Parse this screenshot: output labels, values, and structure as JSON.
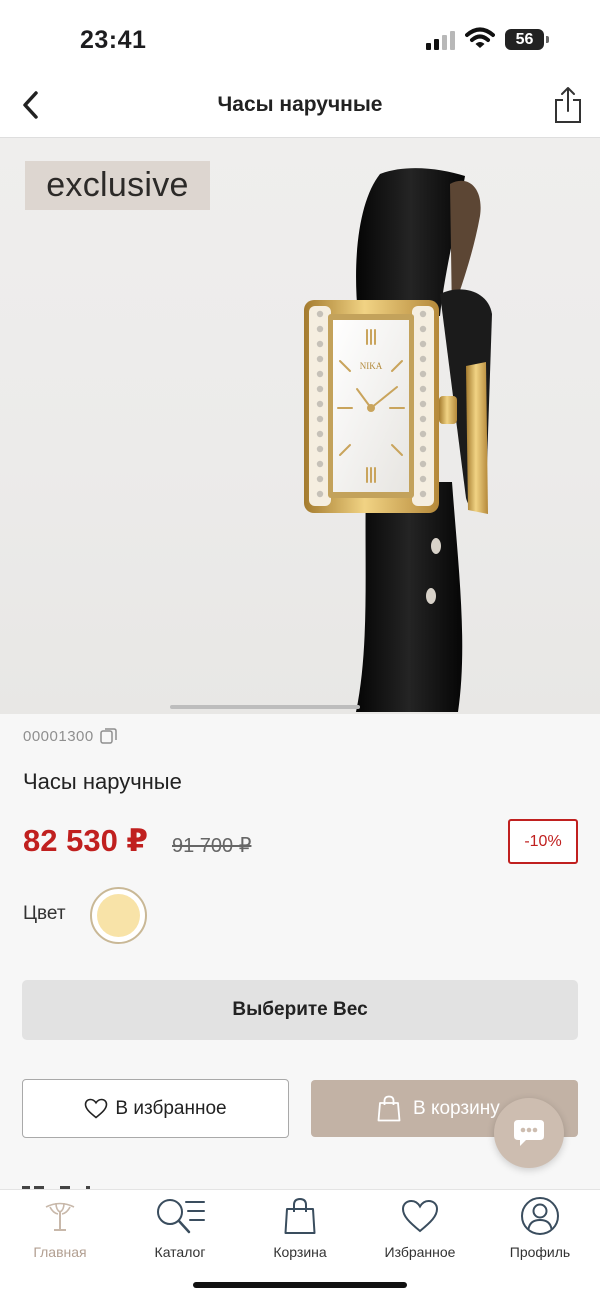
{
  "status_bar": {
    "time": "23:41",
    "battery": "56"
  },
  "header": {
    "title": "Часы наручные"
  },
  "product": {
    "badge": "exclusive",
    "watch_brand": "NIKA",
    "article": "00001300",
    "name": "Часы наручные",
    "price": "82 530 ₽",
    "old_price": "91 700 ₽",
    "discount": "-10%",
    "color_label": "Цвет",
    "swatch_color": "#f8e3a8"
  },
  "actions": {
    "select_weight": "Выберите Вес",
    "favorite": "В избранное",
    "cart": "В корзину"
  },
  "tabs": [
    {
      "label": "Главная",
      "icon": "tree-logo-icon",
      "active": true
    },
    {
      "label": "Каталог",
      "icon": "catalog-search-icon",
      "active": false
    },
    {
      "label": "Корзина",
      "icon": "shopping-bag-icon",
      "active": false
    },
    {
      "label": "Избранное",
      "icon": "heart-icon",
      "active": false
    },
    {
      "label": "Профиль",
      "icon": "profile-icon",
      "active": false
    }
  ],
  "colors": {
    "accent": "#c0201f",
    "cart_button": "#c2b2a5",
    "active_tab": "#b29f91"
  }
}
